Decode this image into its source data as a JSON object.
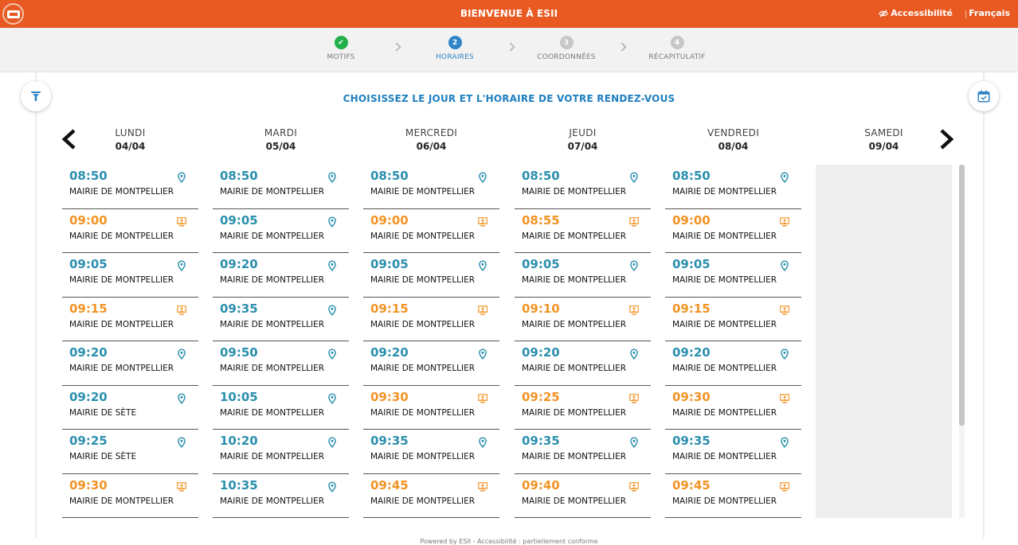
{
  "header": {
    "title": "BIENVENUE À ESII",
    "accessibility_label": "Accessibilité",
    "language_label": "Français",
    "brand_color": "#e85a22"
  },
  "stepper": {
    "steps": [
      {
        "number": "✔",
        "label": "MOTIFS",
        "state": "done"
      },
      {
        "number": "2",
        "label": "HORAIRES",
        "state": "active"
      },
      {
        "number": "3",
        "label": "COORDONNÉES",
        "state": "todo"
      },
      {
        "number": "4",
        "label": "RÉCAPITULATIF",
        "state": "todo"
      }
    ]
  },
  "main": {
    "heading": "CHOISISSEZ LE JOUR ET L'HORAIRE DE VOTRE RENDEZ-VOUS",
    "filter_icon": "filter-icon",
    "calendar_icon": "calendar-check-icon",
    "prev_icon": "chevron-left-icon",
    "next_icon": "chevron-right-icon",
    "days": [
      {
        "name": "LUNDI",
        "date": "04/04",
        "slots": [
          {
            "time": "08:50",
            "location": "MAIRIE DE MONTPELLIER",
            "type": "inperson"
          },
          {
            "time": "09:00",
            "location": "MAIRIE DE MONTPELLIER",
            "type": "video"
          },
          {
            "time": "09:05",
            "location": "MAIRIE DE MONTPELLIER",
            "type": "inperson"
          },
          {
            "time": "09:15",
            "location": "MAIRIE DE MONTPELLIER",
            "type": "video"
          },
          {
            "time": "09:20",
            "location": "MAIRIE DE MONTPELLIER",
            "type": "inperson"
          },
          {
            "time": "09:20",
            "location": "MAIRIE DE SÈTE",
            "type": "inperson"
          },
          {
            "time": "09:25",
            "location": "MAIRIE DE SÈTE",
            "type": "inperson"
          },
          {
            "time": "09:30",
            "location": "MAIRIE DE MONTPELLIER",
            "type": "video"
          }
        ]
      },
      {
        "name": "MARDI",
        "date": "05/04",
        "slots": [
          {
            "time": "08:50",
            "location": "MAIRIE DE MONTPELLIER",
            "type": "inperson"
          },
          {
            "time": "09:05",
            "location": "MAIRIE DE MONTPELLIER",
            "type": "inperson"
          },
          {
            "time": "09:20",
            "location": "MAIRIE DE MONTPELLIER",
            "type": "inperson"
          },
          {
            "time": "09:35",
            "location": "MAIRIE DE MONTPELLIER",
            "type": "inperson"
          },
          {
            "time": "09:50",
            "location": "MAIRIE DE MONTPELLIER",
            "type": "inperson"
          },
          {
            "time": "10:05",
            "location": "MAIRIE DE MONTPELLIER",
            "type": "inperson"
          },
          {
            "time": "10:20",
            "location": "MAIRIE DE MONTPELLIER",
            "type": "inperson"
          },
          {
            "time": "10:35",
            "location": "MAIRIE DE MONTPELLIER",
            "type": "inperson"
          }
        ]
      },
      {
        "name": "MERCREDI",
        "date": "06/04",
        "slots": [
          {
            "time": "08:50",
            "location": "MAIRIE DE MONTPELLIER",
            "type": "inperson"
          },
          {
            "time": "09:00",
            "location": "MAIRIE DE MONTPELLIER",
            "type": "video"
          },
          {
            "time": "09:05",
            "location": "MAIRIE DE MONTPELLIER",
            "type": "inperson"
          },
          {
            "time": "09:15",
            "location": "MAIRIE DE MONTPELLIER",
            "type": "video"
          },
          {
            "time": "09:20",
            "location": "MAIRIE DE MONTPELLIER",
            "type": "inperson"
          },
          {
            "time": "09:30",
            "location": "MAIRIE DE MONTPELLIER",
            "type": "video"
          },
          {
            "time": "09:35",
            "location": "MAIRIE DE MONTPELLIER",
            "type": "inperson"
          },
          {
            "time": "09:45",
            "location": "MAIRIE DE MONTPELLIER",
            "type": "video"
          }
        ]
      },
      {
        "name": "JEUDI",
        "date": "07/04",
        "slots": [
          {
            "time": "08:50",
            "location": "MAIRIE DE MONTPELLIER",
            "type": "inperson"
          },
          {
            "time": "08:55",
            "location": "MAIRIE DE MONTPELLIER",
            "type": "video"
          },
          {
            "time": "09:05",
            "location": "MAIRIE DE MONTPELLIER",
            "type": "inperson"
          },
          {
            "time": "09:10",
            "location": "MAIRIE DE MONTPELLIER",
            "type": "video"
          },
          {
            "time": "09:20",
            "location": "MAIRIE DE MONTPELLIER",
            "type": "inperson"
          },
          {
            "time": "09:25",
            "location": "MAIRIE DE MONTPELLIER",
            "type": "video"
          },
          {
            "time": "09:35",
            "location": "MAIRIE DE MONTPELLIER",
            "type": "inperson"
          },
          {
            "time": "09:40",
            "location": "MAIRIE DE MONTPELLIER",
            "type": "video"
          }
        ]
      },
      {
        "name": "VENDREDI",
        "date": "08/04",
        "slots": [
          {
            "time": "08:50",
            "location": "MAIRIE DE MONTPELLIER",
            "type": "inperson"
          },
          {
            "time": "09:00",
            "location": "MAIRIE DE MONTPELLIER",
            "type": "video"
          },
          {
            "time": "09:05",
            "location": "MAIRIE DE MONTPELLIER",
            "type": "inperson"
          },
          {
            "time": "09:15",
            "location": "MAIRIE DE MONTPELLIER",
            "type": "video"
          },
          {
            "time": "09:20",
            "location": "MAIRIE DE MONTPELLIER",
            "type": "inperson"
          },
          {
            "time": "09:30",
            "location": "MAIRIE DE MONTPELLIER",
            "type": "video"
          },
          {
            "time": "09:35",
            "location": "MAIRIE DE MONTPELLIER",
            "type": "inperson"
          },
          {
            "time": "09:45",
            "location": "MAIRIE DE MONTPELLIER",
            "type": "video"
          }
        ]
      },
      {
        "name": "SAMEDI",
        "date": "09/04",
        "slots": []
      }
    ],
    "colors": {
      "inperson": "#2b8fae",
      "video": "#f29324",
      "heading": "#1e7fc0"
    }
  },
  "footer": {
    "text": "Powered by ESII - Accessibilité : partiellement conforme"
  }
}
